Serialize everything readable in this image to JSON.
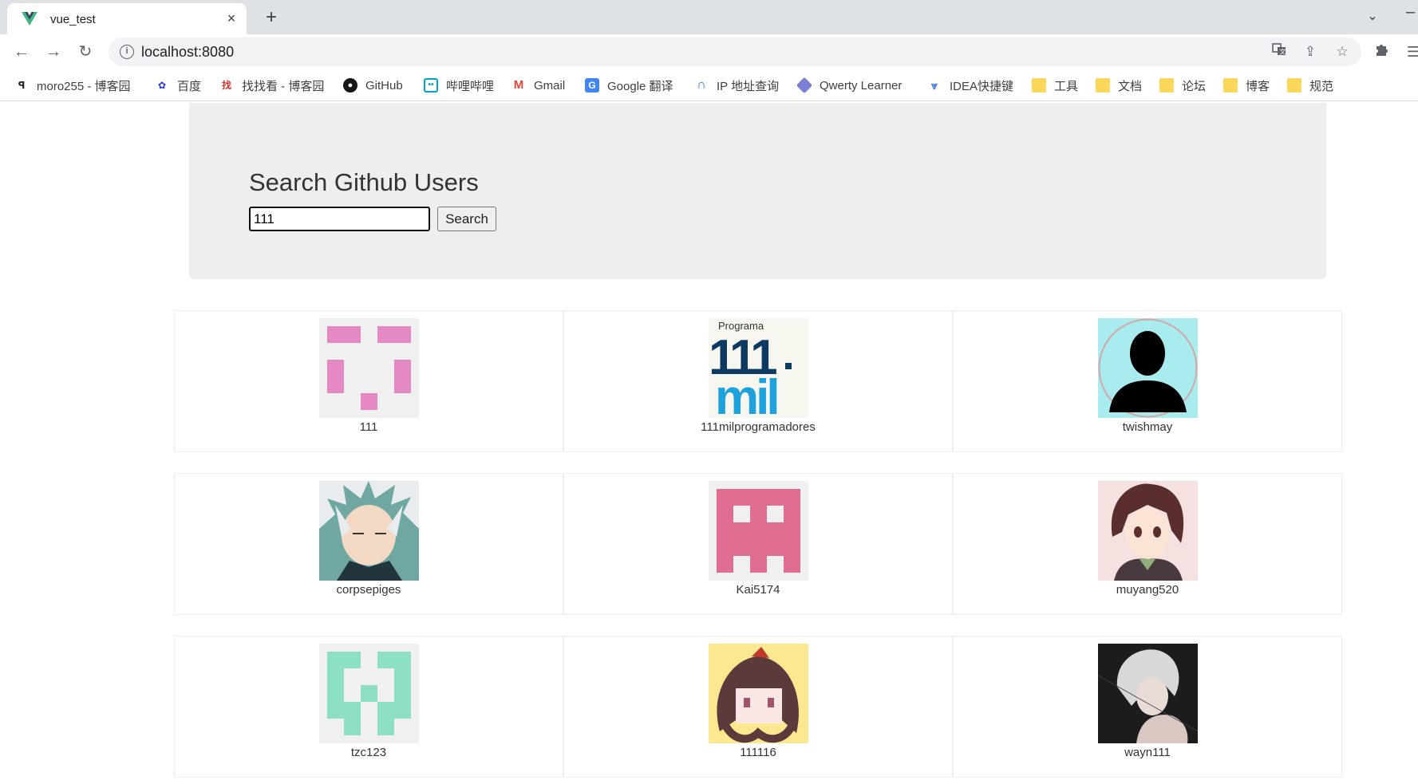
{
  "browser": {
    "tab_title": "vue_test",
    "close_glyph": "×",
    "new_tab_glyph": "+",
    "url": "localhost:8080",
    "bookmarks": [
      {
        "label": "moro255 - 博客园",
        "icon": "cnblogs-icon"
      },
      {
        "label": "百度",
        "icon": "baidu-icon"
      },
      {
        "label": "找找看 - 博客园",
        "icon": "zhaozhaokan-icon"
      },
      {
        "label": "GitHub",
        "icon": "github-icon"
      },
      {
        "label": "哔哩哔哩",
        "icon": "bilibili-icon"
      },
      {
        "label": "Gmail",
        "icon": "gmail-icon"
      },
      {
        "label": "Google 翻译",
        "icon": "google-translate-icon"
      },
      {
        "label": "IP 地址查询",
        "icon": "ip-lookup-icon"
      },
      {
        "label": "Qwerty Learner",
        "icon": "qwerty-icon"
      },
      {
        "label": "IDEA快捷键",
        "icon": "idea-icon"
      },
      {
        "label": "工具",
        "icon": "folder-icon"
      },
      {
        "label": "文档",
        "icon": "folder-icon"
      },
      {
        "label": "论坛",
        "icon": "folder-icon"
      },
      {
        "label": "博客",
        "icon": "folder-icon"
      },
      {
        "label": "规范",
        "icon": "folder-icon"
      }
    ]
  },
  "search": {
    "heading": "Search Github Users",
    "input_value": "111",
    "button_label": "Search"
  },
  "users": [
    {
      "login": "111",
      "avatar": "pink-identicon"
    },
    {
      "login": "111milprogramadores",
      "avatar": "111mil-logo"
    },
    {
      "login": "twishmay",
      "avatar": "silhouette"
    },
    {
      "login": "corpsepiges",
      "avatar": "anime-white-hair"
    },
    {
      "login": "Kai5174",
      "avatar": "red-identicon"
    },
    {
      "login": "muyang520",
      "avatar": "anime-boy"
    },
    {
      "login": "tzc123",
      "avatar": "green-identicon"
    },
    {
      "login": "111116",
      "avatar": "anime-girl-yellow"
    },
    {
      "login": "wayn111",
      "avatar": "anime-dark"
    }
  ],
  "logo_text": {
    "programa": "Programa",
    "one_eleven": "111",
    "mil": "mil"
  },
  "colors": {
    "vue_green": "#41b883",
    "vue_dark": "#35495e",
    "folder": "#fbd85a",
    "jumbotron": "#eeeeee"
  }
}
